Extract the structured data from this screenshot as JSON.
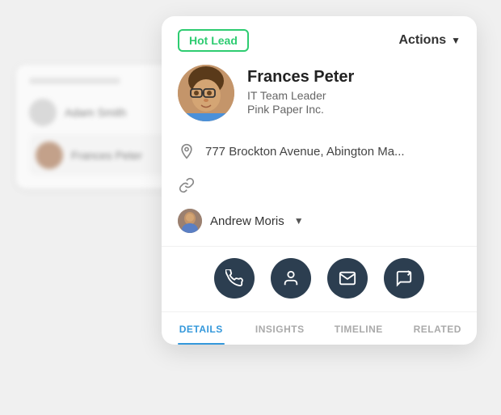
{
  "badge": {
    "label": "Hot Lead"
  },
  "actions": {
    "label": "Actions"
  },
  "profile": {
    "name": "Frances Peter",
    "role": "IT Team Leader",
    "company": "Pink Paper Inc."
  },
  "info": {
    "address": "777 Brockton Avenue, Abington Ma...",
    "link_placeholder": "link"
  },
  "owner": {
    "name": "Andrew Moris"
  },
  "action_buttons": [
    {
      "id": "phone",
      "icon": "phone",
      "label": "Phone"
    },
    {
      "id": "contact",
      "icon": "contact",
      "label": "Contact"
    },
    {
      "id": "email",
      "icon": "email",
      "label": "Email"
    },
    {
      "id": "message",
      "icon": "message",
      "label": "Message"
    }
  ],
  "tabs": [
    {
      "id": "details",
      "label": "DETAILS",
      "active": true
    },
    {
      "id": "insights",
      "label": "INSIGHTS",
      "active": false
    },
    {
      "id": "timeline",
      "label": "TIMELINE",
      "active": false
    },
    {
      "id": "related",
      "label": "RELATED",
      "active": false
    }
  ],
  "bg_contacts": [
    {
      "name": "Adam Smith"
    },
    {
      "name": "Frances Peter"
    }
  ]
}
